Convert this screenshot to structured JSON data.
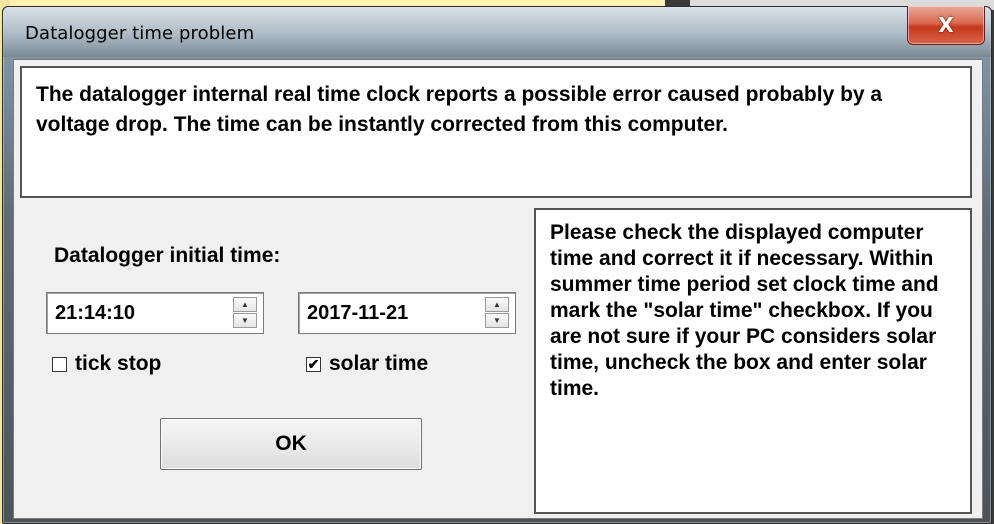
{
  "window": {
    "title": "Datalogger time problem",
    "close_label": "X"
  },
  "message": "The datalogger internal real time clock reports a possible error caused probably by a voltage drop. The time can be instantly corrected from this computer.",
  "form": {
    "initial_time_label": "Datalogger initial time:",
    "time_value": "21:14:10",
    "date_value": "2017-11-21",
    "tick_stop_label": "tick stop",
    "tick_stop_checked": false,
    "solar_time_label": "solar time",
    "solar_time_checked": true,
    "ok_label": "OK"
  },
  "help_text": "Please check the displayed computer time and correct it if necessary. Within summer time period set clock time and mark the \"solar time\" checkbox. If you are not sure if your PC considers solar time, uncheck the box and enter solar time."
}
